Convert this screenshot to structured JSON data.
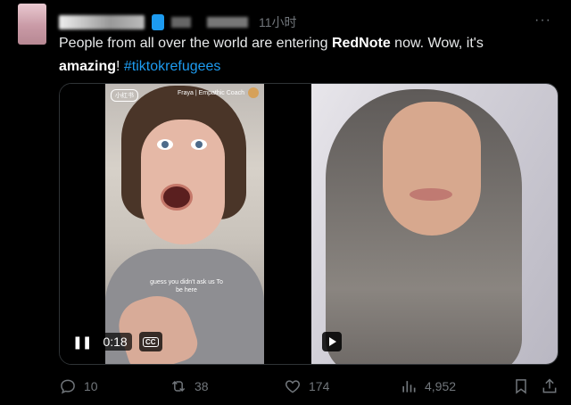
{
  "tweet": {
    "time": "11小时",
    "text_parts": {
      "p1": "People from all over the world are entering ",
      "brand": "RedNote",
      "p2": " now. Wow, it's ",
      "amazing": "amazing",
      "p3": "! ",
      "hashtag": "#tiktokrefugees"
    }
  },
  "media": {
    "video": {
      "app_badge": "小红书",
      "creator": "Fraya | Empathic Coach",
      "subtitle": "guess you didn't ask us To be here",
      "elapsed": "0:18",
      "cc_label": "CC"
    }
  },
  "actions": {
    "replies": "10",
    "retweets": "38",
    "likes": "174",
    "views": "4,952"
  },
  "icons": [
    "reply-icon",
    "retweet-icon",
    "like-icon",
    "views-icon",
    "bookmark-icon",
    "share-icon",
    "more-icon",
    "pause-icon",
    "cc-icon",
    "play-icon"
  ]
}
